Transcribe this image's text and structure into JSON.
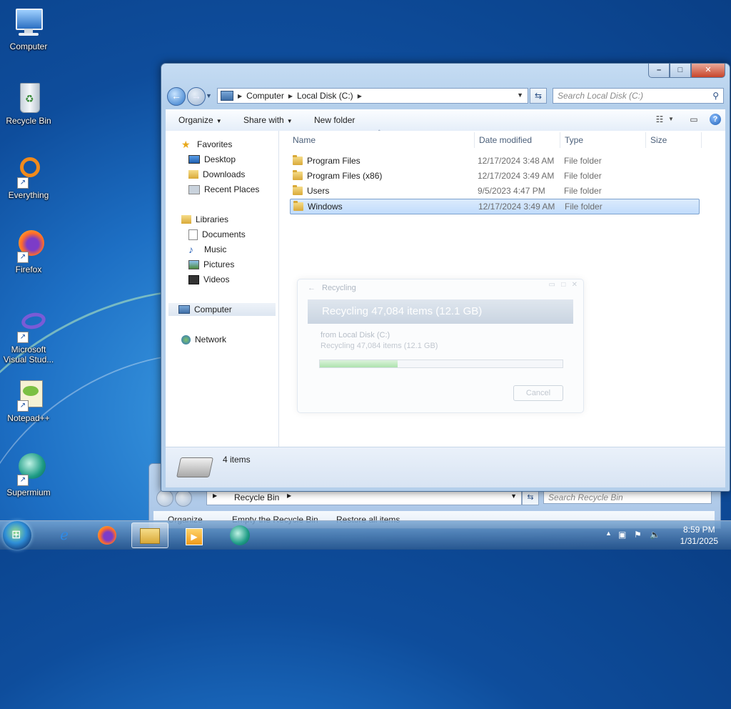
{
  "desktop": {
    "icons": [
      {
        "label": "Computer"
      },
      {
        "label": "Recycle Bin"
      },
      {
        "label": "Everything"
      },
      {
        "label": "Firefox"
      },
      {
        "label": "Microsoft Visual Stud..."
      },
      {
        "label": "Notepad++"
      },
      {
        "label": "Supermium"
      }
    ]
  },
  "back_window": {
    "breadcrumb": "Recycle Bin",
    "search_placeholder": "Search Recycle Bin",
    "commands": [
      "Organize",
      "Empty the Recycle Bin",
      "Restore all items"
    ]
  },
  "explorer": {
    "breadcrumb": [
      "Computer",
      "Local Disk (C:)"
    ],
    "search_placeholder": "Search Local Disk (C:)",
    "commands": {
      "organize": "Organize",
      "share_with": "Share with",
      "new_folder": "New folder"
    },
    "nav": {
      "favorites": "Favorites",
      "desktop": "Desktop",
      "downloads": "Downloads",
      "recent": "Recent Places",
      "libraries": "Libraries",
      "documents": "Documents",
      "music": "Music",
      "pictures": "Pictures",
      "videos": "Videos",
      "computer": "Computer",
      "network": "Network"
    },
    "columns": {
      "name": "Name",
      "date": "Date modified",
      "type": "Type",
      "size": "Size"
    },
    "files": [
      {
        "name": "Program Files",
        "date": "12/17/2024 3:48 AM",
        "type": "File folder"
      },
      {
        "name": "Program Files (x86)",
        "date": "12/17/2024 3:49 AM",
        "type": "File folder"
      },
      {
        "name": "Users",
        "date": "9/5/2023 4:47 PM",
        "type": "File folder"
      },
      {
        "name": "Windows",
        "date": "12/17/2024 3:49 AM",
        "type": "File folder",
        "selected": true
      }
    ],
    "status": "4 items"
  },
  "progress_dialog": {
    "title": "Recycling",
    "heading": "Recycling 47,084 items (12.1 GB)",
    "from": "from Local Disk (C:)",
    "detail": "Recycling 47,084 items (12.1 GB)",
    "progress_fraction": 0.32,
    "cancel": "Cancel"
  },
  "taskbar": {
    "time": "8:59 PM",
    "date": "1/31/2025"
  },
  "colors": {
    "accent": "#2e76c9",
    "selection": "#c1dcfc",
    "taskbar": "#2d5a8e"
  }
}
